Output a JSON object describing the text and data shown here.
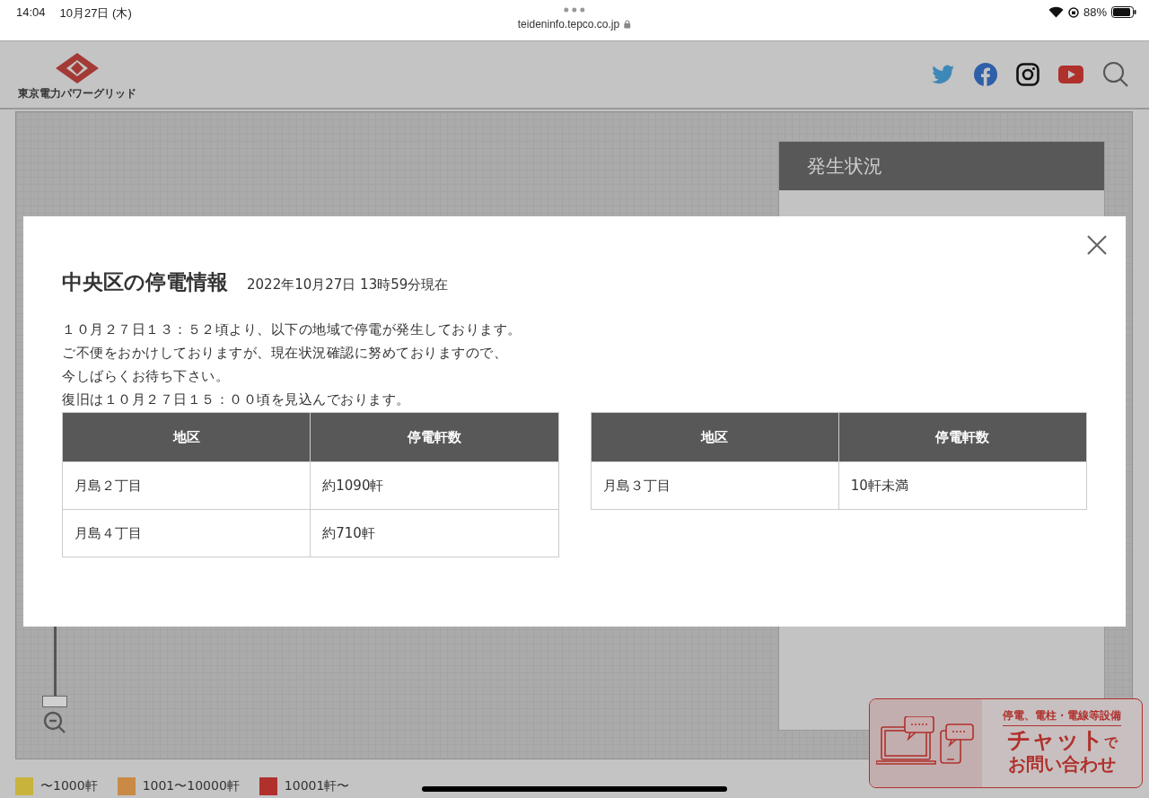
{
  "status_bar": {
    "time": "14:04",
    "date": "10月27日 (木)",
    "url": "teideninfo.tepco.co.jp",
    "battery": "88%"
  },
  "header": {
    "logo_text": "東京電力パワーグリッド"
  },
  "side_panel": {
    "title": "発生状況"
  },
  "legend": [
    {
      "label": "〜1000軒",
      "color": "#c8b33c"
    },
    {
      "label": "1001〜10000軒",
      "color": "#c98a45"
    },
    {
      "label": "10001軒〜",
      "color": "#b0302c"
    }
  ],
  "chat_banner": {
    "line_1": "停電、電柱・電線等設備",
    "line_2": "チャット",
    "line_2_suffix": "で",
    "line_3": "お問い合わせ"
  },
  "modal": {
    "title": "中央区の停電情報",
    "timestamp": "2022年10月27日 13時59分現在",
    "message": [
      "１０月２７日１３：５２頃より、以下の地域で停電が発生しております。",
      "ご不便をおかけしておりますが、現在状況確認に努めておりますので、",
      "今しばらくお待ち下さい。",
      "復旧は１０月２７日１５：００頃を見込んでおります。"
    ],
    "tables": [
      {
        "columns": [
          "地区",
          "停電軒数"
        ],
        "rows": [
          [
            "月島２丁目",
            "約1090軒"
          ],
          [
            "月島４丁目",
            "約710軒"
          ]
        ]
      },
      {
        "columns": [
          "地区",
          "停電軒数"
        ],
        "rows": [
          [
            "月島３丁目",
            "10軒未満"
          ]
        ]
      }
    ]
  }
}
